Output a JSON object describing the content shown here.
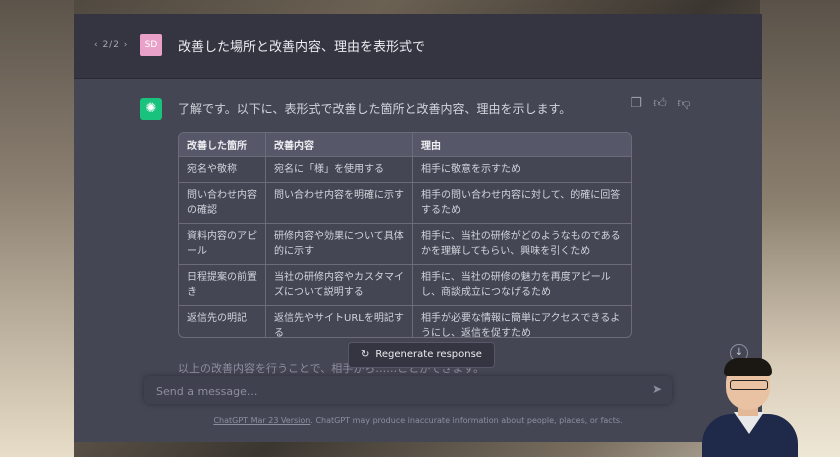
{
  "conversation": {
    "nav": "‹ 2/2 ›",
    "user_initials": "SD",
    "user_message": "改善した場所と改善内容、理由を表形式で",
    "assistant_intro": "了解です。以下に、表形式で改善した箇所と改善内容、理由を示します。",
    "table": {
      "headers": [
        "改善した箇所",
        "改善内容",
        "理由"
      ],
      "rows": [
        [
          "宛名や敬称",
          "宛名に「様」を使用する",
          "相手に敬意を示すため"
        ],
        [
          "問い合わせ内容の確認",
          "問い合わせ内容を明確に示す",
          "相手の問い合わせ内容に対して、的確に回答するため"
        ],
        [
          "資料内容のアピール",
          "研修内容や効果について具体的に示す",
          "相手に、当社の研修がどのようなものであるかを理解してもらい、興味を引くため"
        ],
        [
          "日程提案の前置き",
          "当社の研修内容やカスタマイズについて説明する",
          "相手に、当社の研修の魅力を再度アピールし、商談成立につなげるため"
        ],
        [
          "返信先の明記",
          "返信先やサイトURLを明記する",
          "相手が必要な情報に簡単にアクセスできるようにし、返信を促すため"
        ]
      ]
    },
    "assistant_outro": "以上の改善内容を行うことで、相手から……ことができます。"
  },
  "controls": {
    "regenerate_label": "Regenerate response",
    "composer_placeholder": "Send a message...",
    "copy_icon": "clipboard-icon",
    "thumbs_up_icon": "thumbs-up-icon",
    "thumbs_down_icon": "thumbs-down-icon"
  },
  "footer": {
    "link_text": "ChatGPT Mar 23 Version",
    "text": ". ChatGPT may produce inaccurate information about people, places, or facts."
  },
  "colors": {
    "chat_bg": "#444654",
    "user_row_bg": "#343541",
    "gpt_avatar": "#19c37d",
    "user_avatar": "#e9a0c9"
  }
}
